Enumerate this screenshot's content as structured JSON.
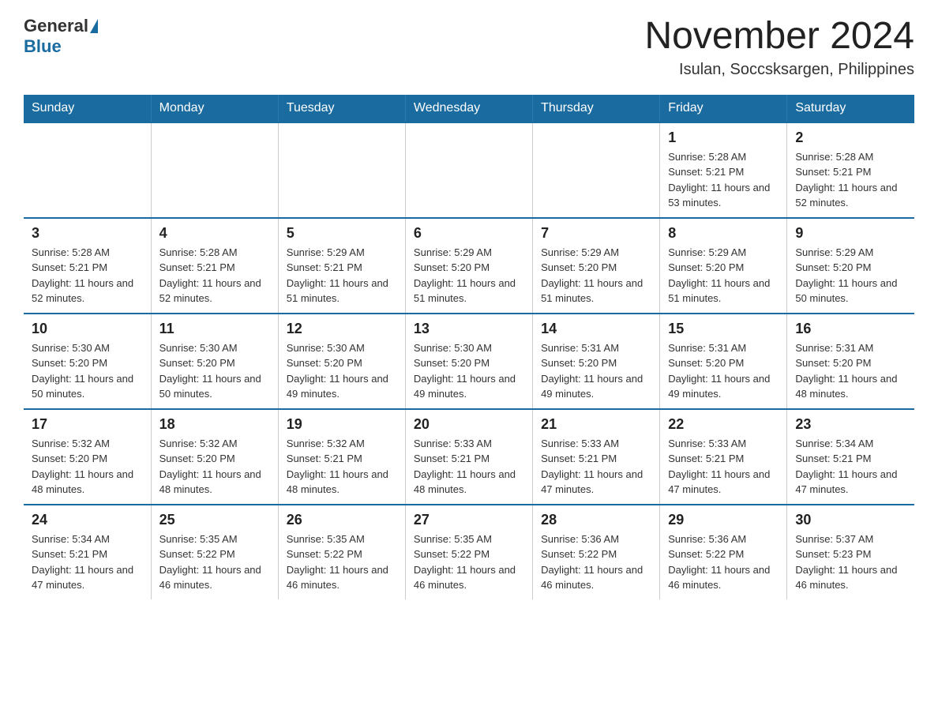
{
  "logo": {
    "text_general": "General",
    "text_blue": "Blue"
  },
  "header": {
    "month": "November 2024",
    "location": "Isulan, Soccsksargen, Philippines"
  },
  "weekdays": [
    "Sunday",
    "Monday",
    "Tuesday",
    "Wednesday",
    "Thursday",
    "Friday",
    "Saturday"
  ],
  "weeks": [
    [
      {
        "day": "",
        "info": ""
      },
      {
        "day": "",
        "info": ""
      },
      {
        "day": "",
        "info": ""
      },
      {
        "day": "",
        "info": ""
      },
      {
        "day": "",
        "info": ""
      },
      {
        "day": "1",
        "info": "Sunrise: 5:28 AM\nSunset: 5:21 PM\nDaylight: 11 hours and 53 minutes."
      },
      {
        "day": "2",
        "info": "Sunrise: 5:28 AM\nSunset: 5:21 PM\nDaylight: 11 hours and 52 minutes."
      }
    ],
    [
      {
        "day": "3",
        "info": "Sunrise: 5:28 AM\nSunset: 5:21 PM\nDaylight: 11 hours and 52 minutes."
      },
      {
        "day": "4",
        "info": "Sunrise: 5:28 AM\nSunset: 5:21 PM\nDaylight: 11 hours and 52 minutes."
      },
      {
        "day": "5",
        "info": "Sunrise: 5:29 AM\nSunset: 5:21 PM\nDaylight: 11 hours and 51 minutes."
      },
      {
        "day": "6",
        "info": "Sunrise: 5:29 AM\nSunset: 5:20 PM\nDaylight: 11 hours and 51 minutes."
      },
      {
        "day": "7",
        "info": "Sunrise: 5:29 AM\nSunset: 5:20 PM\nDaylight: 11 hours and 51 minutes."
      },
      {
        "day": "8",
        "info": "Sunrise: 5:29 AM\nSunset: 5:20 PM\nDaylight: 11 hours and 51 minutes."
      },
      {
        "day": "9",
        "info": "Sunrise: 5:29 AM\nSunset: 5:20 PM\nDaylight: 11 hours and 50 minutes."
      }
    ],
    [
      {
        "day": "10",
        "info": "Sunrise: 5:30 AM\nSunset: 5:20 PM\nDaylight: 11 hours and 50 minutes."
      },
      {
        "day": "11",
        "info": "Sunrise: 5:30 AM\nSunset: 5:20 PM\nDaylight: 11 hours and 50 minutes."
      },
      {
        "day": "12",
        "info": "Sunrise: 5:30 AM\nSunset: 5:20 PM\nDaylight: 11 hours and 49 minutes."
      },
      {
        "day": "13",
        "info": "Sunrise: 5:30 AM\nSunset: 5:20 PM\nDaylight: 11 hours and 49 minutes."
      },
      {
        "day": "14",
        "info": "Sunrise: 5:31 AM\nSunset: 5:20 PM\nDaylight: 11 hours and 49 minutes."
      },
      {
        "day": "15",
        "info": "Sunrise: 5:31 AM\nSunset: 5:20 PM\nDaylight: 11 hours and 49 minutes."
      },
      {
        "day": "16",
        "info": "Sunrise: 5:31 AM\nSunset: 5:20 PM\nDaylight: 11 hours and 48 minutes."
      }
    ],
    [
      {
        "day": "17",
        "info": "Sunrise: 5:32 AM\nSunset: 5:20 PM\nDaylight: 11 hours and 48 minutes."
      },
      {
        "day": "18",
        "info": "Sunrise: 5:32 AM\nSunset: 5:20 PM\nDaylight: 11 hours and 48 minutes."
      },
      {
        "day": "19",
        "info": "Sunrise: 5:32 AM\nSunset: 5:21 PM\nDaylight: 11 hours and 48 minutes."
      },
      {
        "day": "20",
        "info": "Sunrise: 5:33 AM\nSunset: 5:21 PM\nDaylight: 11 hours and 48 minutes."
      },
      {
        "day": "21",
        "info": "Sunrise: 5:33 AM\nSunset: 5:21 PM\nDaylight: 11 hours and 47 minutes."
      },
      {
        "day": "22",
        "info": "Sunrise: 5:33 AM\nSunset: 5:21 PM\nDaylight: 11 hours and 47 minutes."
      },
      {
        "day": "23",
        "info": "Sunrise: 5:34 AM\nSunset: 5:21 PM\nDaylight: 11 hours and 47 minutes."
      }
    ],
    [
      {
        "day": "24",
        "info": "Sunrise: 5:34 AM\nSunset: 5:21 PM\nDaylight: 11 hours and 47 minutes."
      },
      {
        "day": "25",
        "info": "Sunrise: 5:35 AM\nSunset: 5:22 PM\nDaylight: 11 hours and 46 minutes."
      },
      {
        "day": "26",
        "info": "Sunrise: 5:35 AM\nSunset: 5:22 PM\nDaylight: 11 hours and 46 minutes."
      },
      {
        "day": "27",
        "info": "Sunrise: 5:35 AM\nSunset: 5:22 PM\nDaylight: 11 hours and 46 minutes."
      },
      {
        "day": "28",
        "info": "Sunrise: 5:36 AM\nSunset: 5:22 PM\nDaylight: 11 hours and 46 minutes."
      },
      {
        "day": "29",
        "info": "Sunrise: 5:36 AM\nSunset: 5:22 PM\nDaylight: 11 hours and 46 minutes."
      },
      {
        "day": "30",
        "info": "Sunrise: 5:37 AM\nSunset: 5:23 PM\nDaylight: 11 hours and 46 minutes."
      }
    ]
  ]
}
